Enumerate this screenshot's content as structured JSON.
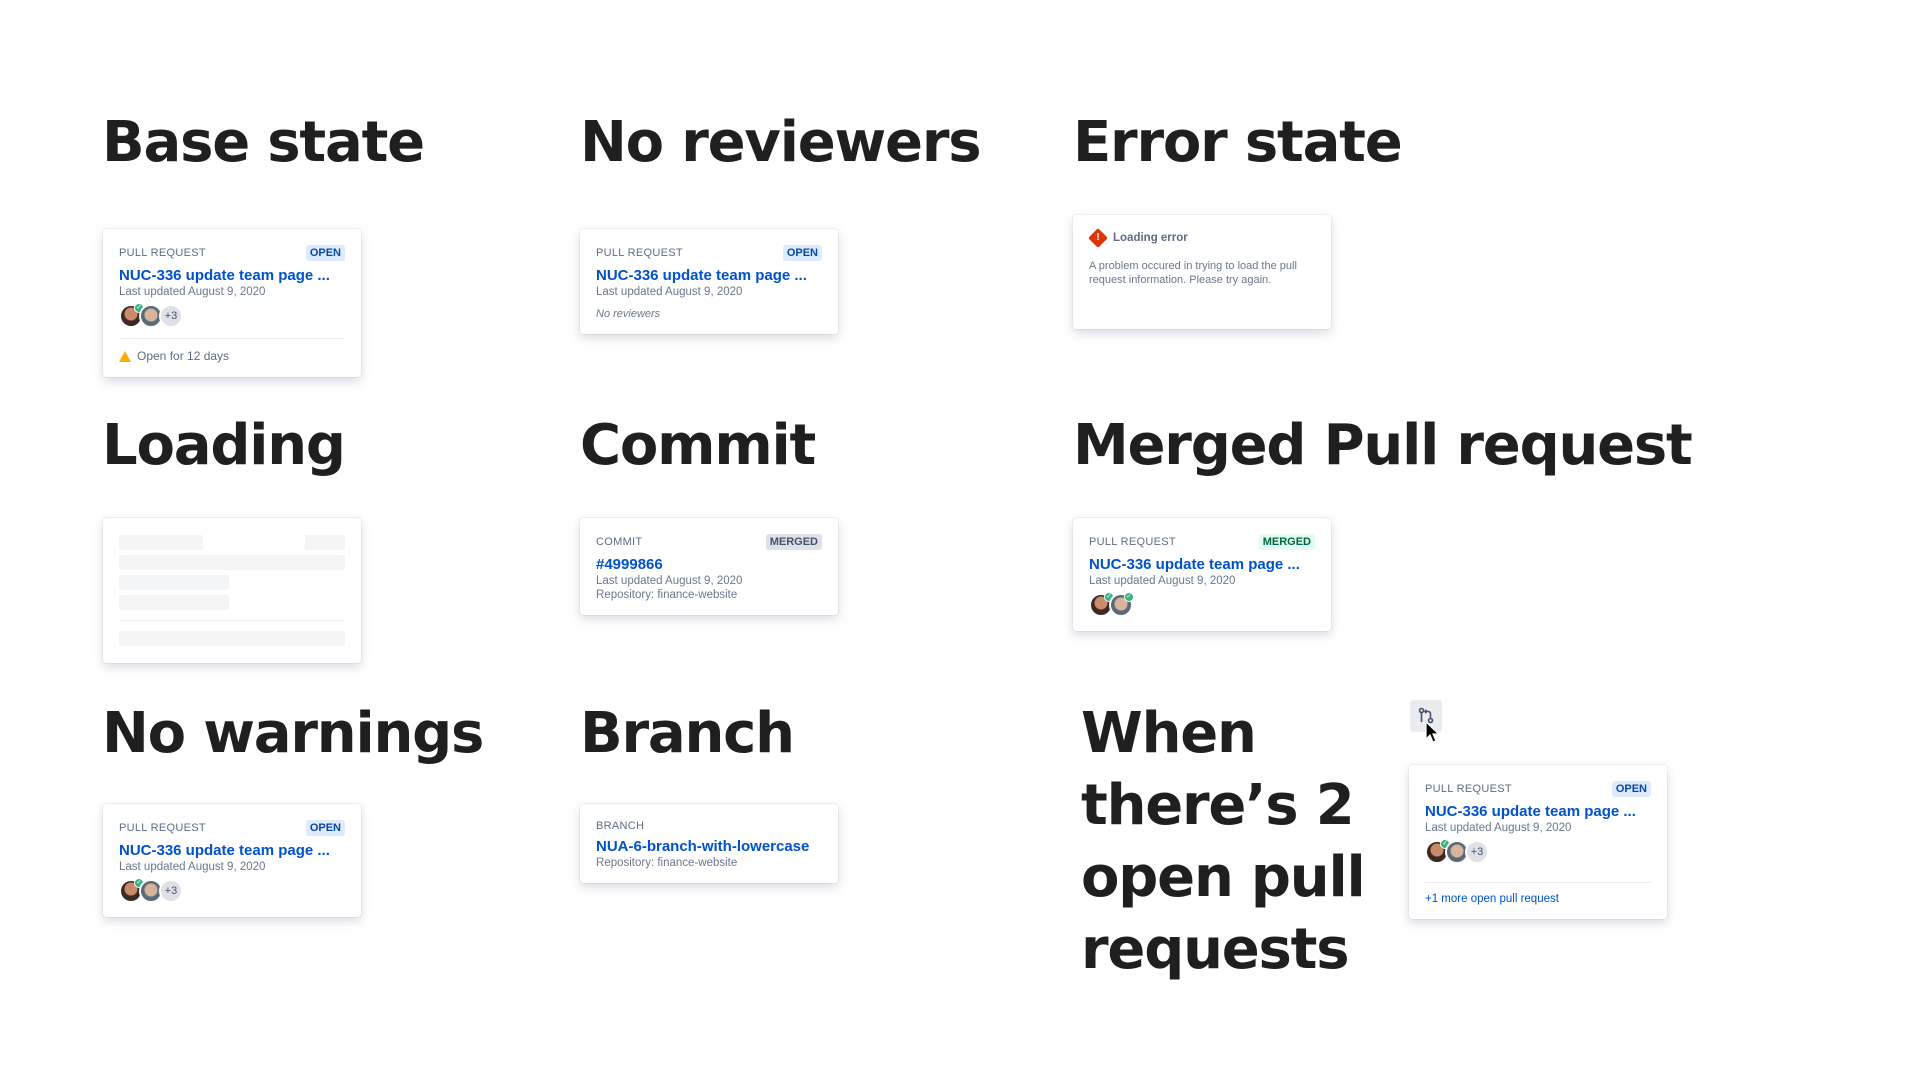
{
  "headings": {
    "base": "Base state",
    "no_reviewers": "No reviewers",
    "error": "Error state",
    "loading": "Loading",
    "commit": "Commit",
    "merged": "Merged Pull request",
    "no_warnings": "No warnings",
    "branch": "Branch",
    "two_open": "When there’s 2 open pull requests"
  },
  "common": {
    "pull_request_label": "PULL REQUEST",
    "pr_title": "NUC-336 update team page ...",
    "last_updated": "Last updated August 9, 2020",
    "open_label": "OPEN",
    "merged_label": "MERGED",
    "extra_reviewers": "+3"
  },
  "base_card": {
    "warning": "Open for 12 days"
  },
  "no_reviewers_card": {
    "note": "No reviewers"
  },
  "error_card": {
    "title": "Loading error",
    "message": "A problem occured in trying to load the pull request information. Please try again."
  },
  "commit_card": {
    "type_label": "COMMIT",
    "title": "#4999866",
    "repository": "Repository: finance-website"
  },
  "branch_card": {
    "type_label": "BRANCH",
    "title": "NUA-6-branch-with-lowercase",
    "repository": "Repository: finance-website"
  },
  "two_open_card": {
    "more_link": "+1 more open pull request"
  },
  "icons": {
    "pull_request": "pull-request-icon",
    "cursor": "mouse-pointer-icon",
    "warning": "warning-icon",
    "error": "error-icon",
    "check": "check-icon"
  },
  "colors": {
    "link_blue": "#0052cc",
    "open_bg": "#deebff",
    "merged_bg": "#e3fcef",
    "success": "#36b37e",
    "warning": "#ffab00",
    "error": "#de350b"
  }
}
